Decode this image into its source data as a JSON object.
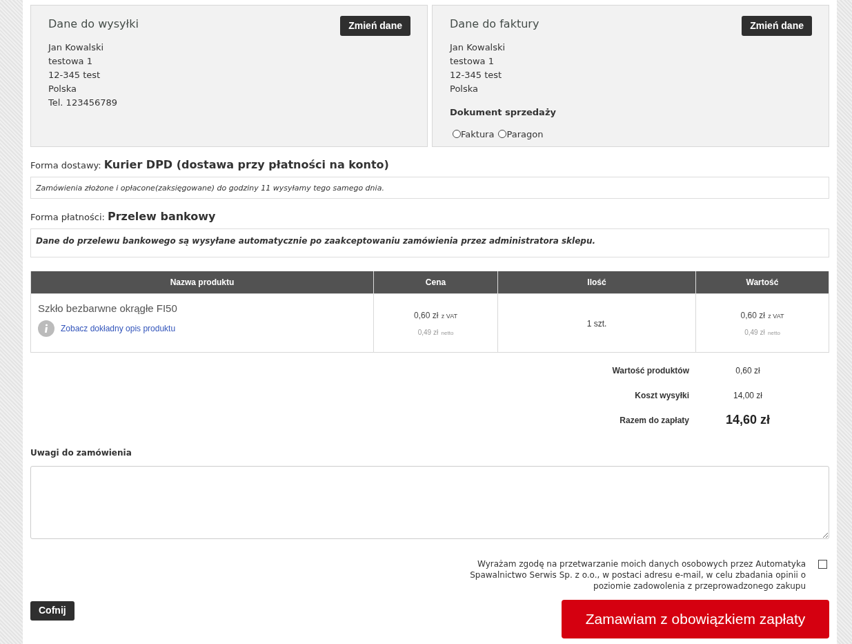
{
  "shipping": {
    "title": "Dane do wysyłki",
    "button": "Zmień dane",
    "lines": [
      "Jan Kowalski",
      "testowa 1",
      "12-345 test",
      "Polska",
      "Tel. 123456789"
    ]
  },
  "billing": {
    "title": "Dane do faktury",
    "button": "Zmień dane",
    "lines": [
      "Jan Kowalski",
      "testowa 1",
      "12-345 test",
      "Polska"
    ],
    "document_label": "Dokument sprzedaży",
    "document_options": [
      {
        "label": "Faktura",
        "selected": false
      },
      {
        "label": "Paragon",
        "selected": false
      }
    ]
  },
  "delivery": {
    "label": "Forma dostawy:",
    "value": "Kurier DPD (dostawa przy płatności na konto)",
    "note": "Zamówienia złożone i opłacone(zaksięgowane) do godziny 11 wysyłamy tego samego dnia."
  },
  "payment": {
    "label": "Forma płatności:",
    "value": "Przelew bankowy",
    "note": "Dane do przelewu bankowego są wysyłane automatycznie po zaakceptowaniu zamówienia przez administratora sklepu."
  },
  "table": {
    "columns": [
      "Nazwa produktu",
      "Cena",
      "Ilość",
      "Wartość"
    ],
    "rows": [
      {
        "name": "Szkło bezbarwne okrągłe FI50",
        "link": "Zobacz dokładny opis produktu",
        "price": {
          "gross": "0,60 zł",
          "gross_suffix": "z VAT",
          "net": "0,49 zł",
          "net_suffix": "netto"
        },
        "quantity": "1 szt.",
        "value": {
          "gross": "0,60 zł",
          "gross_suffix": "z VAT",
          "net": "0,49 zł",
          "net_suffix": "netto"
        }
      }
    ]
  },
  "summary": [
    {
      "label": "Wartość produktów",
      "value": "0,60 zł",
      "total": false
    },
    {
      "label": "Koszt wysyłki",
      "value": "14,00 zł",
      "total": false
    },
    {
      "label": "Razem do zapłaty",
      "value": "14,60 zł",
      "total": true
    }
  ],
  "notes": {
    "label": "Uwagi do zamówienia"
  },
  "consent": {
    "text": "Wyrażam zgodę na przetwarzanie moich danych osobowych przez Automatyka Spawalnictwo Serwis Sp. z o.o., w postaci adresu e-mail, w celu zbadania opinii o poziomie zadowolenia z przeprowadzonego zakupu",
    "checked": false
  },
  "back_button": "Cofnij",
  "order_button": "Zamawiam z obowiązkiem zapłaty"
}
